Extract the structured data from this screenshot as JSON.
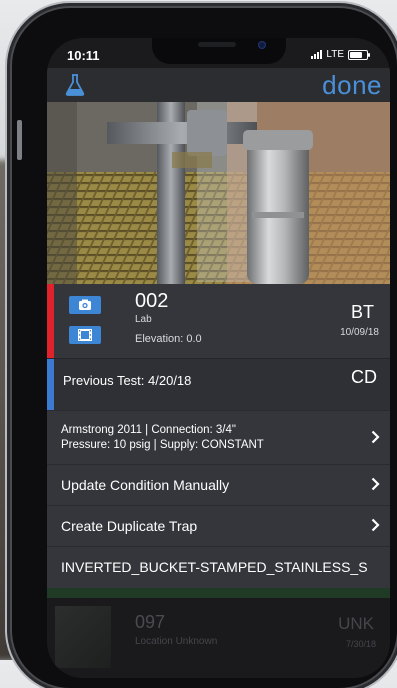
{
  "statusbar": {
    "time": "10:11",
    "carrier": "LTE",
    "battery_level": 0.75
  },
  "navbar": {
    "lab_icon": "flask-icon",
    "done_label": "done"
  },
  "trap": {
    "number": "002",
    "location": "Lab",
    "elevation": "Elevation: 0.0",
    "type_code": "BT",
    "date": "10/09/18",
    "camera_icon": "camera-icon",
    "video_icon": "film-icon"
  },
  "previous_test": {
    "label": "Previous Test: 4/20/18",
    "code": "CD"
  },
  "spec": {
    "line1": "Armstrong 2011 | Connection: 3/4\"",
    "line2": "Pressure: 10 psig | Supply: CONSTANT"
  },
  "menu": {
    "update_condition": "Update Condition Manually",
    "create_duplicate": "Create Duplicate Trap",
    "trap_type": "INVERTED_BUCKET-STAMPED_STAINLESS_S"
  },
  "behind_card": {
    "number": "097",
    "location": "Location Unknown",
    "code": "UNK",
    "date": "7/30/18"
  },
  "colors": {
    "accent_red": "#e0222c",
    "accent_blue": "#3a7ad0",
    "link_blue": "#4a90d9",
    "button_blue": "#3d86d6"
  }
}
